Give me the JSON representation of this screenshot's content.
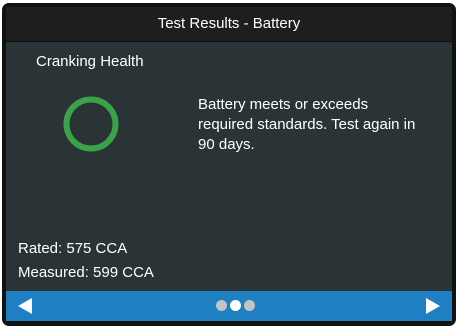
{
  "header": {
    "title": "Test Results - Battery"
  },
  "result": {
    "section_title": "Cranking Health",
    "status_icon": "ring-icon",
    "status_color": "#3aa34a",
    "message": "Battery meets or exceeds required standards. Test again in 90 days."
  },
  "ratings": {
    "rated": "Rated: 575 CCA",
    "measured": "Measured: 599 CCA"
  },
  "nav": {
    "left_icon": "left-arrow-icon",
    "right_icon": "right-arrow-icon",
    "page_count": 3,
    "active_page": 2,
    "bar_color": "#1f7fc3"
  }
}
